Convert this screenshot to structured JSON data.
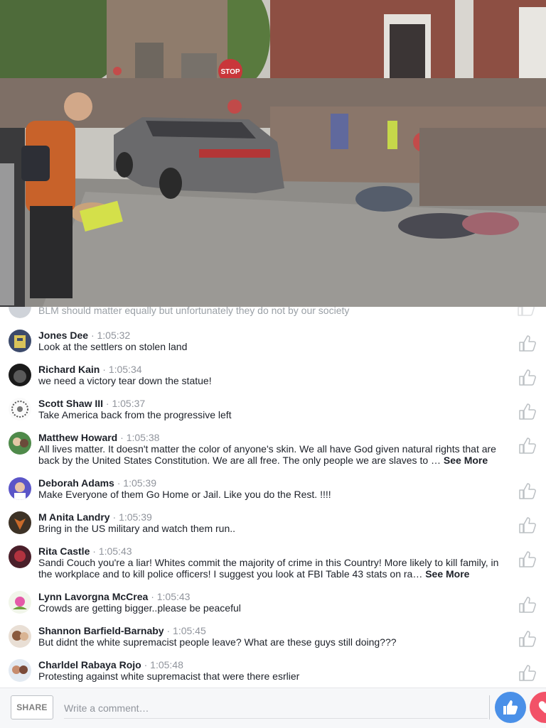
{
  "video": {
    "sign_text": "STOP"
  },
  "partial_comment": {
    "text": "BLM should matter equally but unfortunately they do not by our society"
  },
  "comments": [
    {
      "author": "Jones Dee",
      "time": "1:05:32",
      "text": "Look at the settlers on stolen land",
      "see_more": ""
    },
    {
      "author": "Richard Kain",
      "time": "1:05:34",
      "text": "we need a victory tear down the statue!",
      "see_more": ""
    },
    {
      "author": "Scott Shaw III",
      "time": "1:05:37",
      "text": "Take America back from the progressive left",
      "see_more": ""
    },
    {
      "author": "Matthew Howard",
      "time": "1:05:38",
      "text": "All lives matter. It doesn't matter the color of anyone's skin. We all have God given natural rights that are back by the United States Constitution. We are all free. The only people we are slaves to …",
      "see_more": "See More"
    },
    {
      "author": "Deborah Adams",
      "time": "1:05:39",
      "text": "Make Everyone of them Go Home or Jail. Like you do the Rest. !!!!",
      "see_more": ""
    },
    {
      "author": "M Anita Landry",
      "time": "1:05:39",
      "text": "Bring in the US military and watch them run..",
      "see_more": ""
    },
    {
      "author": "Rita Castle",
      "time": "1:05:43",
      "text": "Sandi Couch you're a liar! Whites commit the majority of crime in this Country! More likely to kill family, in the workplace and to kill police officers! I suggest you look at FBI Table 43 stats on ra…",
      "see_more": "See More"
    },
    {
      "author": "Lynn Lavorgna McCrea",
      "time": "1:05:43",
      "text": "Crowds are getting bigger..please be peaceful",
      "see_more": ""
    },
    {
      "author": "Shannon Barfield-Barnaby",
      "time": "1:05:45",
      "text": "But didnt the white supremacist people leave? What are these guys still doing???",
      "see_more": ""
    },
    {
      "author": "Charldel Rabaya Rojo",
      "time": "1:05:48",
      "text": "Protesting against white supremacist that were there esrlier",
      "see_more": ""
    }
  ],
  "separator": "·",
  "footer": {
    "share_label": "SHARE",
    "comment_placeholder": "Write a comment…"
  },
  "colors": {
    "link_blue": "#4a90e8",
    "heart_red": "#f25268",
    "meta_gray": "#90949c"
  },
  "icons": {
    "like": "thumbs-up-outline-icon",
    "react_like": "thumbs-up-filled-icon",
    "react_love": "heart-icon"
  }
}
